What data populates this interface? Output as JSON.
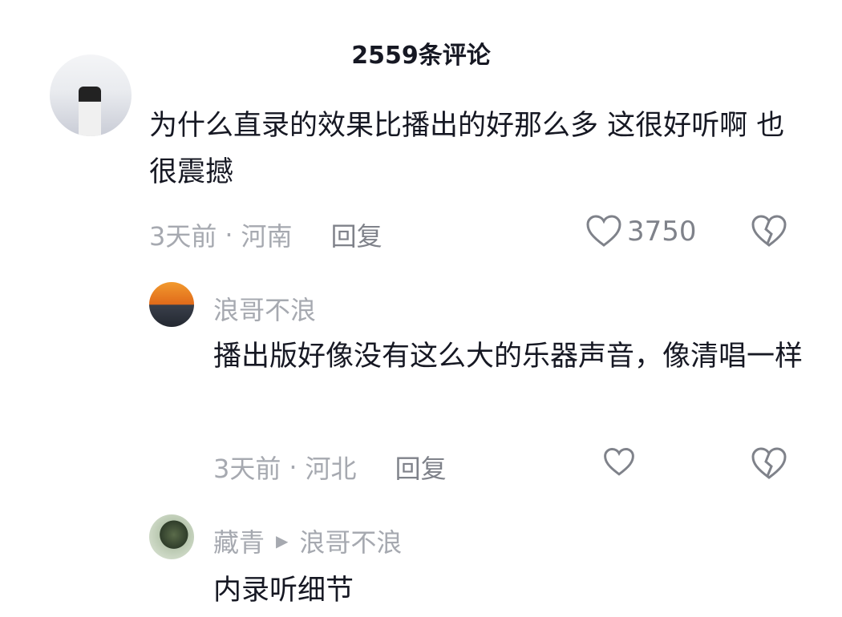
{
  "header": {
    "title": "2559条评论"
  },
  "comments": [
    {
      "text": "为什么直录的效果比播出的好那么多  这很好听啊 也很震撼",
      "time": "3天前",
      "location": "河南",
      "reply_label": "回复",
      "likes": "3750",
      "replies": [
        {
          "username": "浪哥不浪",
          "text": "播出版好像没有这么大的乐器声音，像清唱一样",
          "time": "3天前",
          "location": "河北",
          "reply_label": "回复"
        },
        {
          "username": "藏青",
          "reply_to": "浪哥不浪",
          "text": "内录听细节"
        }
      ]
    }
  ],
  "separator": "·",
  "icons": {
    "like": "heart-outline-icon",
    "dislike": "broken-heart-icon",
    "reply_arrow": "play-triangle-icon"
  },
  "colors": {
    "text": "#161823",
    "meta": "#a6a9b0",
    "icon": "#7f828a"
  }
}
